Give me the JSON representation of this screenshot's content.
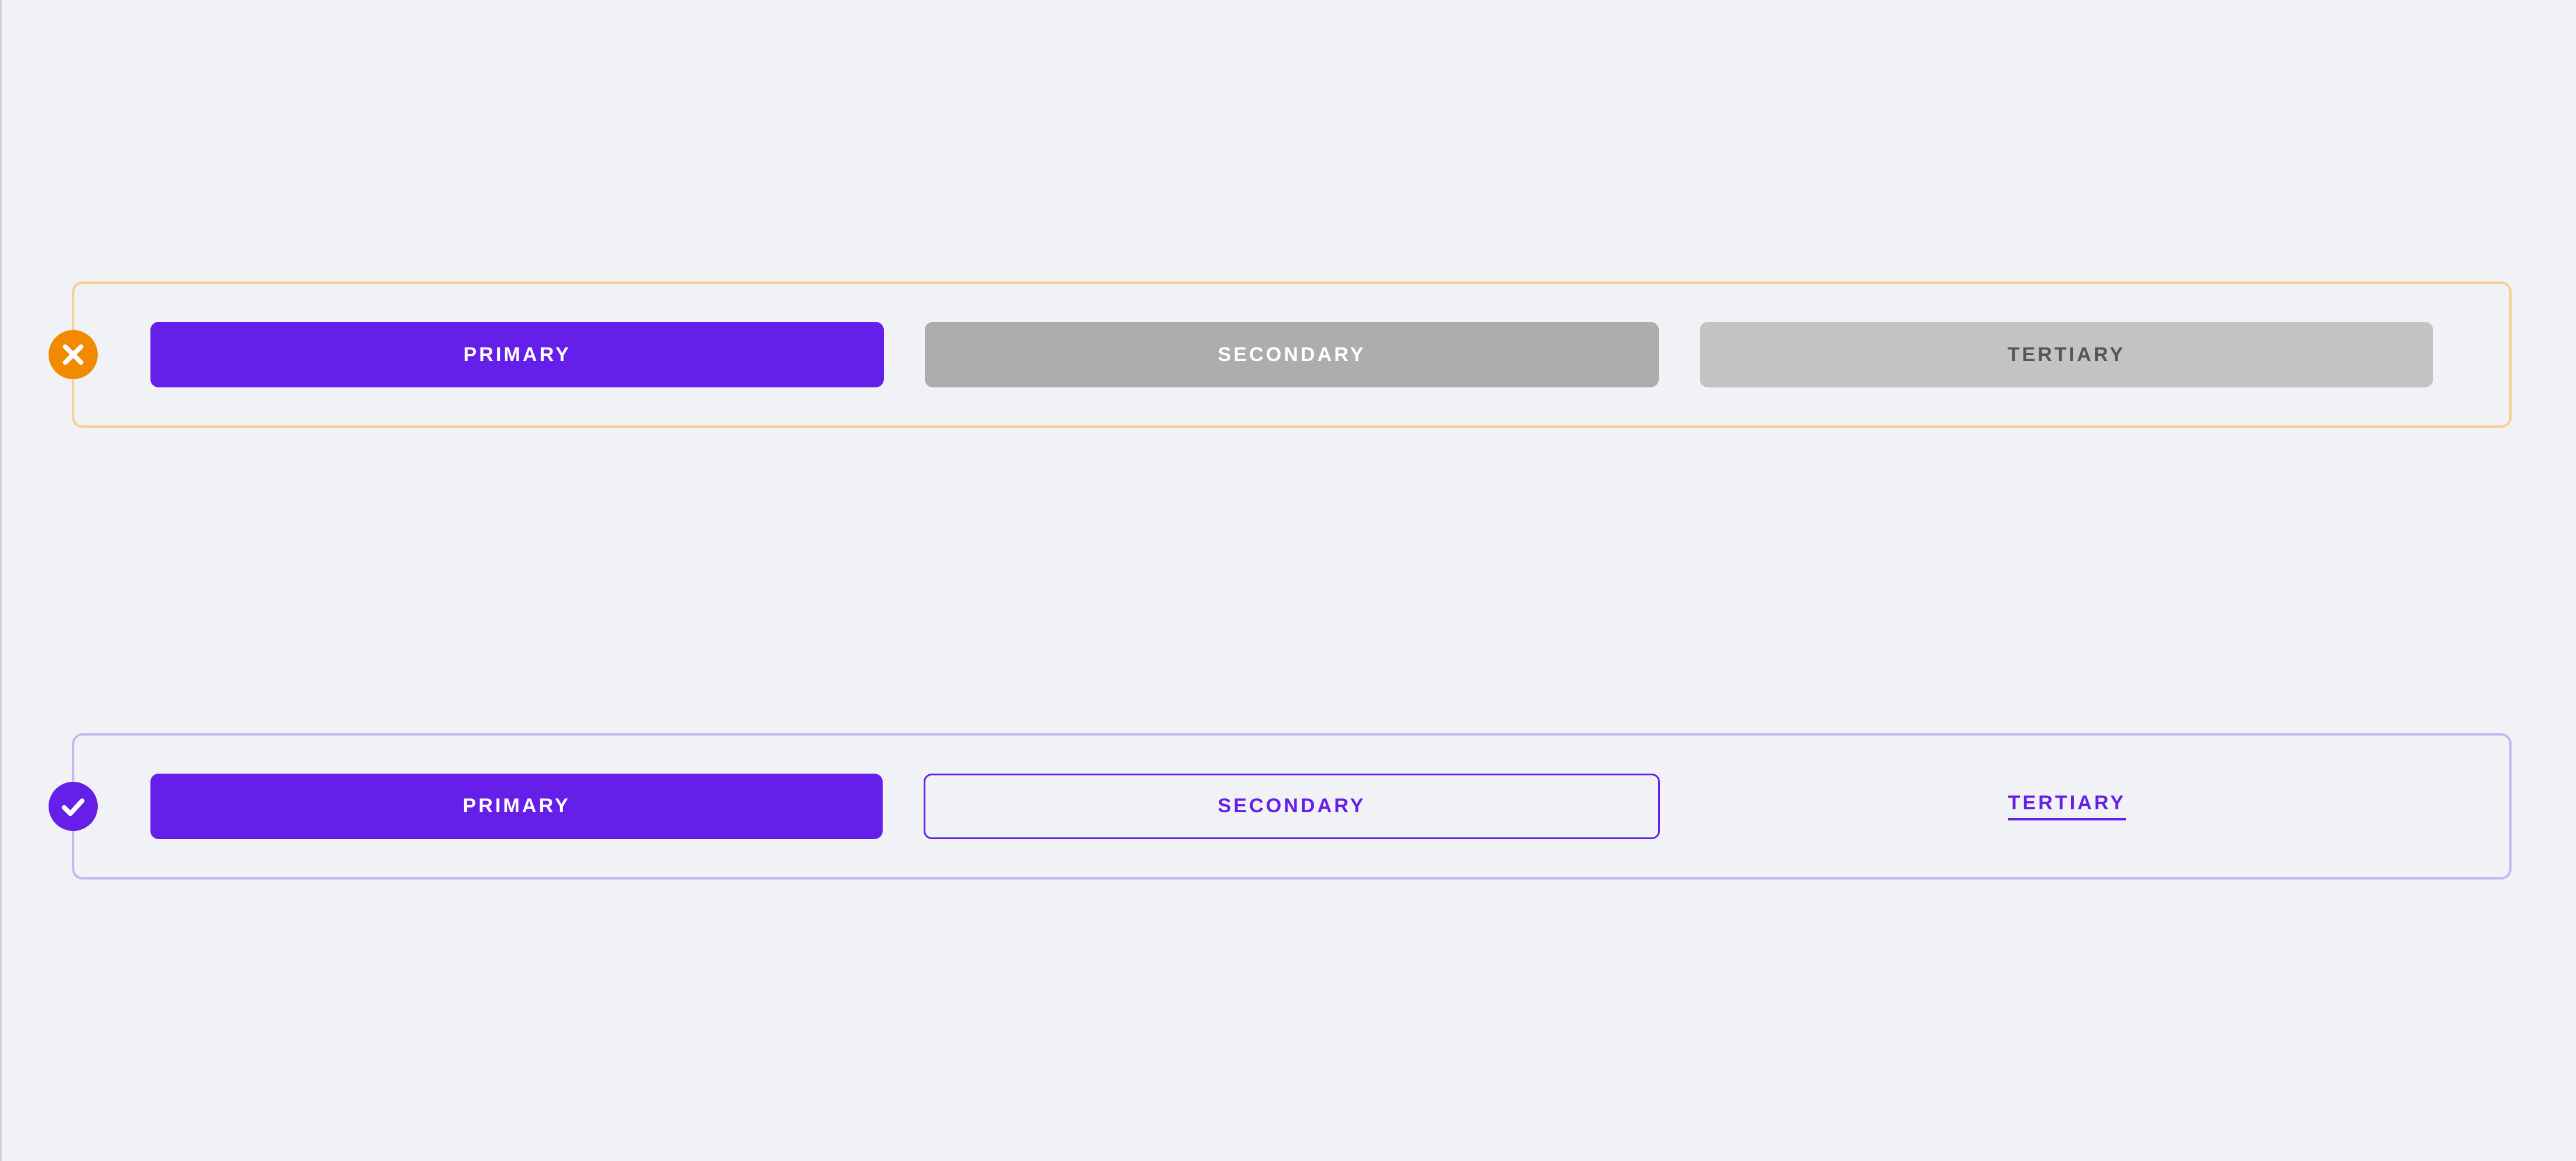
{
  "colors": {
    "accent_purple": "#651fe8",
    "accent_orange": "#f18a00",
    "panel_bad_border": "#f6cf94",
    "panel_good_border": "#c9b6f5",
    "gray_mid": "#adadad",
    "gray_light": "#c3c3c3",
    "gray_dark_text": "#555560",
    "background": "#f1f2f5"
  },
  "bad_example": {
    "status": "incorrect",
    "icon": "cross-icon",
    "buttons": {
      "primary": {
        "label": "PRIMARY"
      },
      "secondary": {
        "label": "SECONDARY"
      },
      "tertiary": {
        "label": "TERTIARY"
      }
    }
  },
  "good_example": {
    "status": "correct",
    "icon": "check-icon",
    "buttons": {
      "primary": {
        "label": "PRIMARY"
      },
      "secondary": {
        "label": "SECONDARY"
      },
      "tertiary": {
        "label": "TERTIARY"
      }
    }
  }
}
